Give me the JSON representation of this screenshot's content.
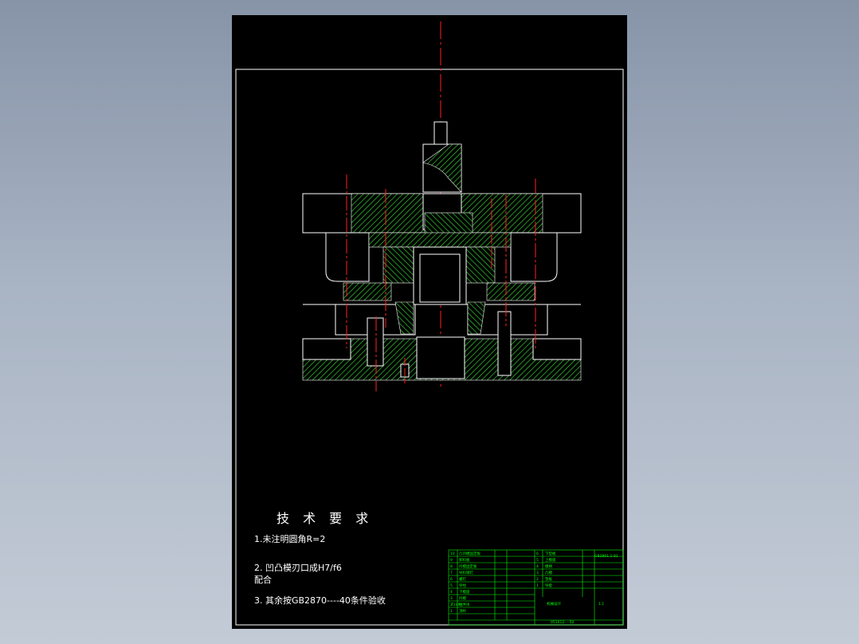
{
  "drawing": {
    "tech_title": "技 术 要 求",
    "notes": [
      "1.未注明圆角R=2",
      "2.  凹凸模刃口成H7/f6",
      "配合",
      "3.  其余按GB2870----40条件验收"
    ]
  },
  "title_block": {
    "parts_left": [
      {
        "no": "10",
        "name": "凸凹模固定板"
      },
      {
        "no": "9",
        "name": "卸料板"
      },
      {
        "no": "8",
        "name": "凹模固定板"
      },
      {
        "no": "7",
        "name": "导料销钉"
      },
      {
        "no": "6",
        "name": "螺钉"
      },
      {
        "no": "5",
        "name": "导柱"
      },
      {
        "no": "4",
        "name": "下模座"
      },
      {
        "no": "3",
        "name": "凹模"
      },
      {
        "no": "2",
        "name": "推件块"
      },
      {
        "no": "1",
        "name": "顶杆"
      }
    ],
    "parts_right": [
      {
        "no": "6",
        "name": "下垫板"
      },
      {
        "no": "5",
        "name": "上模座"
      },
      {
        "no": "4",
        "name": "模柄"
      },
      {
        "no": "3",
        "name": "凸模"
      },
      {
        "no": "2",
        "name": "垫板"
      },
      {
        "no": "1",
        "name": "导套"
      }
    ],
    "material": "T10A",
    "standard": "GB2861.1-81",
    "drawing_no": "051012----50",
    "school": "机械设计",
    "scale": "1:1"
  },
  "colors": {
    "background": "#8c98ab",
    "sheet": "#000000",
    "line": "#ffffff",
    "hatch": "#33cc33",
    "centerline": "#ff2020",
    "title_block": "#00ff00"
  }
}
